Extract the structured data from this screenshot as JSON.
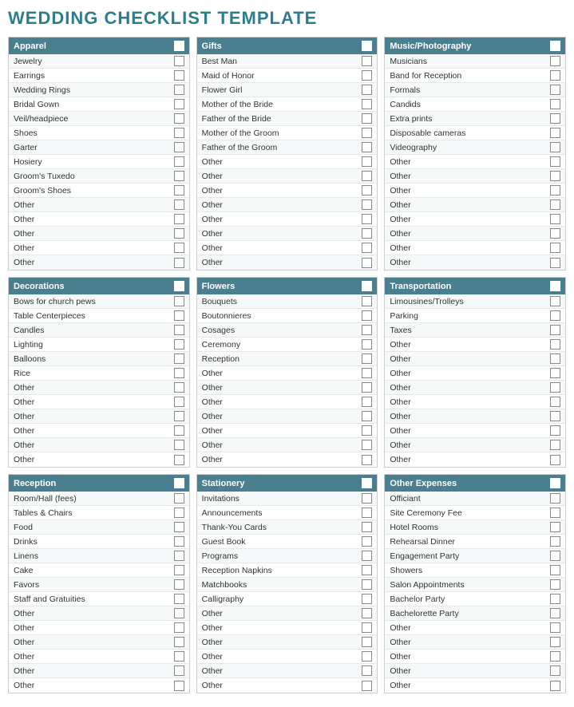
{
  "title": "WEDDING CHECKLIST TEMPLATE",
  "sections": [
    {
      "id": "apparel",
      "label": "Apparel",
      "items": [
        "Jewelry",
        "Earrings",
        "Wedding Rings",
        "Bridal Gown",
        "Veil/headpiece",
        "Shoes",
        "Garter",
        "Hosiery",
        "Groom's Tuxedo",
        "Groom's Shoes",
        "Other",
        "Other",
        "Other",
        "Other",
        "Other"
      ]
    },
    {
      "id": "gifts",
      "label": "Gifts",
      "items": [
        "Best Man",
        "Maid of Honor",
        "Flower Girl",
        "Mother of the Bride",
        "Father of the Bride",
        "Mother of the Groom",
        "Father of the Groom",
        "Other",
        "Other",
        "Other",
        "Other",
        "Other",
        "Other",
        "Other",
        "Other"
      ]
    },
    {
      "id": "music-photography",
      "label": "Music/Photography",
      "items": [
        "Musicians",
        "Band for Reception",
        "Formals",
        "Candids",
        "Extra prints",
        "Disposable cameras",
        "Videography",
        "Other",
        "Other",
        "Other",
        "Other",
        "Other",
        "Other",
        "Other",
        "Other"
      ]
    },
    {
      "id": "decorations",
      "label": "Decorations",
      "items": [
        "Bows for church pews",
        "Table Centerpieces",
        "Candles",
        "Lighting",
        "Balloons",
        "Rice",
        "Other",
        "Other",
        "Other",
        "Other",
        "Other",
        "Other"
      ]
    },
    {
      "id": "flowers",
      "label": "Flowers",
      "items": [
        "Bouquets",
        "Boutonnieres",
        "Cosages",
        "Ceremony",
        "Reception",
        "Other",
        "Other",
        "Other",
        "Other",
        "Other",
        "Other",
        "Other"
      ]
    },
    {
      "id": "transportation",
      "label": "Transportation",
      "items": [
        "Limousines/Trolleys",
        "Parking",
        "Taxes",
        "Other",
        "Other",
        "Other",
        "Other",
        "Other",
        "Other",
        "Other",
        "Other",
        "Other"
      ]
    },
    {
      "id": "reception",
      "label": "Reception",
      "items": [
        "Room/Hall (fees)",
        "Tables & Chairs",
        "Food",
        "Drinks",
        "Linens",
        "Cake",
        "Favors",
        "Staff and Gratuities",
        "Other",
        "Other",
        "Other",
        "Other",
        "Other",
        "Other"
      ]
    },
    {
      "id": "stationery",
      "label": "Stationery",
      "items": [
        "Invitations",
        "Announcements",
        "Thank-You Cards",
        "Guest Book",
        "Programs",
        "Reception Napkins",
        "Matchbooks",
        "Calligraphy",
        "Other",
        "Other",
        "Other",
        "Other",
        "Other",
        "Other"
      ]
    },
    {
      "id": "other-expenses",
      "label": "Other Expenses",
      "items": [
        "Officiant",
        "Site Ceremony Fee",
        "Hotel Rooms",
        "Rehearsal Dinner",
        "Engagement Party",
        "Showers",
        "Salon Appointments",
        "Bachelor Party",
        "Bachelorette Party",
        "Other",
        "Other",
        "Other",
        "Other",
        "Other"
      ]
    }
  ]
}
